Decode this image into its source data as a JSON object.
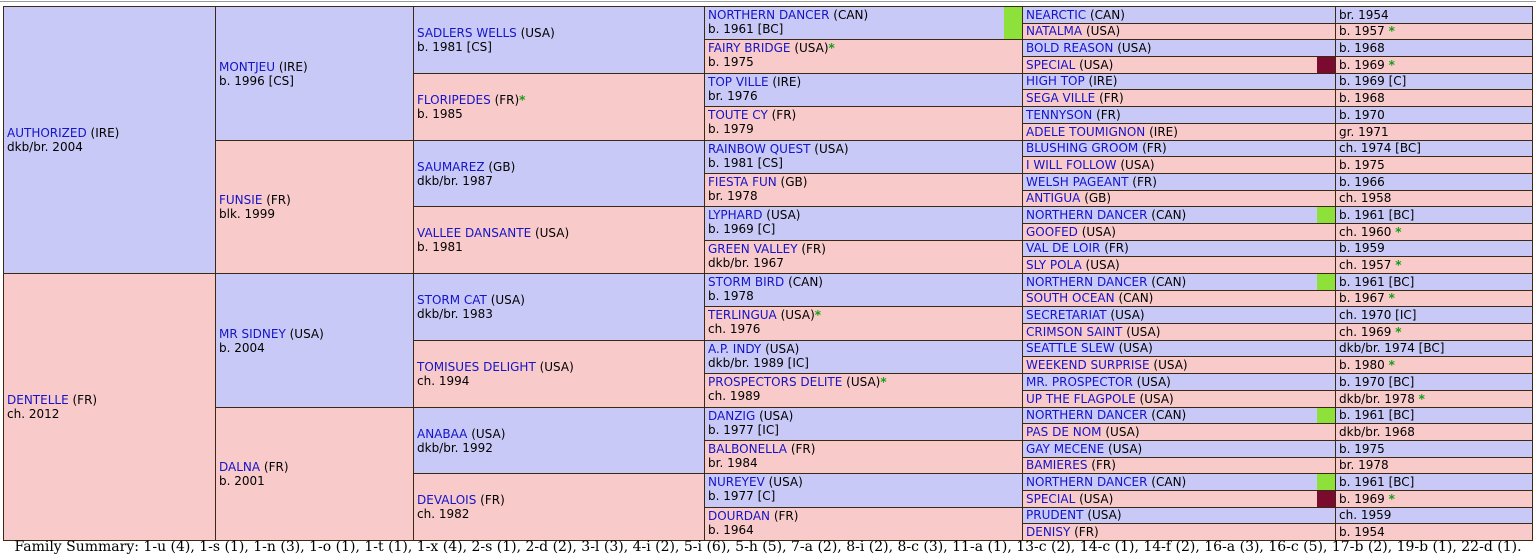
{
  "colors": {
    "male": "#c9c9f7",
    "female": "#f8caca",
    "inbreed_green": "#8ee03a",
    "inbreed_maroon": "#7a0a2e",
    "star": "#11a011",
    "link": "#1414c8"
  },
  "gen1": [
    {
      "name": "AUTHORIZED",
      "country": "(IRE)",
      "info": "dkb/br. 2004",
      "sex": "male"
    },
    {
      "name": "DENTELLE",
      "country": "(FR)",
      "info": "ch. 2012",
      "sex": "female"
    }
  ],
  "gen2": [
    {
      "name": "MONTJEU",
      "country": "(IRE)",
      "info": "b. 1996 [CS]",
      "sex": "male"
    },
    {
      "name": "FUNSIE",
      "country": "(FR)",
      "info": "blk. 1999",
      "sex": "female"
    },
    {
      "name": "MR SIDNEY",
      "country": "(USA)",
      "info": "b. 2004",
      "sex": "male"
    },
    {
      "name": "DALNA",
      "country": "(FR)",
      "info": "b. 2001",
      "sex": "female"
    }
  ],
  "gen3": [
    {
      "name": "SADLERS WELLS",
      "country": "(USA)",
      "star": "",
      "info": "b. 1981 [CS]",
      "sex": "male"
    },
    {
      "name": "FLORIPEDES",
      "country": "(FR)",
      "star": "*",
      "info": "b. 1985",
      "sex": "female"
    },
    {
      "name": "SAUMAREZ",
      "country": "(GB)",
      "star": "",
      "info": "dkb/br. 1987",
      "sex": "male"
    },
    {
      "name": "VALLEE DANSANTE",
      "country": "(USA)",
      "star": "",
      "info": "b. 1981",
      "sex": "female"
    },
    {
      "name": "STORM CAT",
      "country": "(USA)",
      "star": "",
      "info": "dkb/br. 1983",
      "sex": "male"
    },
    {
      "name": "TOMISUES DELIGHT",
      "country": "(USA)",
      "star": "",
      "info": "ch. 1994",
      "sex": "female"
    },
    {
      "name": "ANABAA",
      "country": "(USA)",
      "star": "",
      "info": "dkb/br. 1992",
      "sex": "male"
    },
    {
      "name": "DEVALOIS",
      "country": "(FR)",
      "star": "",
      "info": "ch. 1982",
      "sex": "female"
    }
  ],
  "gen4": [
    {
      "name": "NORTHERN DANCER",
      "country": "(CAN)",
      "star": "",
      "info": "b. 1961 [BC]",
      "sex": "male"
    },
    {
      "name": "FAIRY BRIDGE",
      "country": "(USA)",
      "star": "*",
      "info": "b. 1975",
      "sex": "female"
    },
    {
      "name": "TOP VILLE",
      "country": "(IRE)",
      "star": "",
      "info": "br. 1976",
      "sex": "male"
    },
    {
      "name": "TOUTE CY",
      "country": "(FR)",
      "star": "",
      "info": "b. 1979",
      "sex": "female"
    },
    {
      "name": "RAINBOW QUEST",
      "country": "(USA)",
      "star": "",
      "info": "b. 1981 [CS]",
      "sex": "male"
    },
    {
      "name": "FIESTA FUN",
      "country": "(GB)",
      "star": "",
      "info": "br. 1978",
      "sex": "female"
    },
    {
      "name": "LYPHARD",
      "country": "(USA)",
      "star": "",
      "info": "b. 1969 [C]",
      "sex": "male"
    },
    {
      "name": "GREEN VALLEY",
      "country": "(FR)",
      "star": "",
      "info": "dkb/br. 1967",
      "sex": "female"
    },
    {
      "name": "STORM BIRD",
      "country": "(CAN)",
      "star": "",
      "info": "b. 1978",
      "sex": "male"
    },
    {
      "name": "TERLINGUA",
      "country": "(USA)",
      "star": "*",
      "info": "ch. 1976",
      "sex": "female"
    },
    {
      "name": "A.P. INDY",
      "country": "(USA)",
      "star": "",
      "info": "dkb/br. 1989 [IC]",
      "sex": "male"
    },
    {
      "name": "PROSPECTORS DELITE",
      "country": "(USA)",
      "star": "*",
      "info": "ch. 1989",
      "sex": "female"
    },
    {
      "name": "DANZIG",
      "country": "(USA)",
      "star": "",
      "info": "b. 1977 [IC]",
      "sex": "male"
    },
    {
      "name": "BALBONELLA",
      "country": "(FR)",
      "star": "",
      "info": "br. 1984",
      "sex": "female"
    },
    {
      "name": "NUREYEV",
      "country": "(USA)",
      "star": "",
      "info": "b. 1977 [C]",
      "sex": "male"
    },
    {
      "name": "DOURDAN",
      "country": "(FR)",
      "star": "",
      "info": "b. 1964",
      "sex": "female"
    }
  ],
  "gen5": [
    {
      "name": "NEARCTIC",
      "country": "(CAN)",
      "info": "br. 1954",
      "star": "",
      "sex": "male"
    },
    {
      "name": "NATALMA",
      "country": "(USA)",
      "info": "b. 1957",
      "star": "*",
      "sex": "female"
    },
    {
      "name": "BOLD REASON",
      "country": "(USA)",
      "info": "b. 1968",
      "star": "",
      "sex": "male"
    },
    {
      "name": "SPECIAL",
      "country": "(USA)",
      "info": "b. 1969",
      "star": "*",
      "sex": "female",
      "swatch": "maroon"
    },
    {
      "name": "HIGH TOP",
      "country": "(IRE)",
      "info": "b. 1969 [C]",
      "star": "",
      "sex": "male"
    },
    {
      "name": "SEGA VILLE",
      "country": "(FR)",
      "info": "b. 1968",
      "star": "",
      "sex": "female"
    },
    {
      "name": "TENNYSON",
      "country": "(FR)",
      "info": "b. 1970",
      "star": "",
      "sex": "male"
    },
    {
      "name": "ADELE TOUMIGNON",
      "country": "(IRE)",
      "info": "gr. 1971",
      "star": "",
      "sex": "female"
    },
    {
      "name": "BLUSHING GROOM",
      "country": "(FR)",
      "info": "ch. 1974 [BC]",
      "star": "",
      "sex": "male"
    },
    {
      "name": "I WILL FOLLOW",
      "country": "(USA)",
      "info": "b. 1975",
      "star": "",
      "sex": "female"
    },
    {
      "name": "WELSH PAGEANT",
      "country": "(FR)",
      "info": "b. 1966",
      "star": "",
      "sex": "male"
    },
    {
      "name": "ANTIGUA",
      "country": "(GB)",
      "info": "ch. 1958",
      "star": "",
      "sex": "female"
    },
    {
      "name": "NORTHERN DANCER",
      "country": "(CAN)",
      "info": "b. 1961 [BC]",
      "star": "",
      "sex": "male",
      "swatch": "green"
    },
    {
      "name": "GOOFED",
      "country": "(USA)",
      "info": "ch. 1960",
      "star": "*",
      "sex": "female"
    },
    {
      "name": "VAL DE LOIR",
      "country": "(FR)",
      "info": "b. 1959",
      "star": "",
      "sex": "male"
    },
    {
      "name": "SLY POLA",
      "country": "(USA)",
      "info": "ch. 1957",
      "star": "*",
      "sex": "female"
    },
    {
      "name": "NORTHERN DANCER",
      "country": "(CAN)",
      "info": "b. 1961 [BC]",
      "star": "",
      "sex": "male",
      "swatch": "green"
    },
    {
      "name": "SOUTH OCEAN",
      "country": "(CAN)",
      "info": "b. 1967",
      "star": "*",
      "sex": "female"
    },
    {
      "name": "SECRETARIAT",
      "country": "(USA)",
      "info": "ch. 1970 [IC]",
      "star": "",
      "sex": "male"
    },
    {
      "name": "CRIMSON SAINT",
      "country": "(USA)",
      "info": "ch. 1969",
      "star": "*",
      "sex": "female"
    },
    {
      "name": "SEATTLE SLEW",
      "country": "(USA)",
      "info": "dkb/br. 1974 [BC]",
      "star": "",
      "sex": "male"
    },
    {
      "name": "WEEKEND SURPRISE",
      "country": "(USA)",
      "info": "b. 1980",
      "star": "*",
      "sex": "female"
    },
    {
      "name": "MR. PROSPECTOR",
      "country": "(USA)",
      "info": "b. 1970 [BC]",
      "star": "",
      "sex": "male"
    },
    {
      "name": "UP THE FLAGPOLE",
      "country": "(USA)",
      "info": "dkb/br. 1978",
      "star": "*",
      "sex": "female"
    },
    {
      "name": "NORTHERN DANCER",
      "country": "(CAN)",
      "info": "b. 1961 [BC]",
      "star": "",
      "sex": "male",
      "swatch": "green"
    },
    {
      "name": "PAS DE NOM",
      "country": "(USA)",
      "info": "dkb/br. 1968",
      "star": "",
      "sex": "female"
    },
    {
      "name": "GAY MECENE",
      "country": "(USA)",
      "info": "b. 1975",
      "star": "",
      "sex": "male"
    },
    {
      "name": "BAMIERES",
      "country": "(FR)",
      "info": "br. 1978",
      "star": "",
      "sex": "female"
    },
    {
      "name": "NORTHERN DANCER",
      "country": "(CAN)",
      "info": "b. 1961 [BC]",
      "star": "",
      "sex": "male",
      "swatch": "green"
    },
    {
      "name": "SPECIAL",
      "country": "(USA)",
      "info": "b. 1969",
      "star": "*",
      "sex": "female",
      "swatch": "maroon"
    },
    {
      "name": "PRUDENT",
      "country": "(USA)",
      "info": "ch. 1959",
      "star": "",
      "sex": "male"
    },
    {
      "name": "DENISY",
      "country": "(FR)",
      "info": "b. 1954",
      "star": "",
      "sex": "female"
    }
  ],
  "gen4_first_swatch": "green",
  "footer": "Family Summary: 1-u (4), 1-s (1), 1-n (3), 1-o (1), 1-t (1), 1-x (4), 2-s (1), 2-d (2), 3-l (3), 4-i (2), 5-i (6), 5-h (5), 7-a (2), 8-i (2), 8-c (3), 11-a (1), 13-c (2), 14-c (1), 14-f (2), 16-a (3), 16-c (5), 17-b (2), 19-b (1), 22-d (1)."
}
